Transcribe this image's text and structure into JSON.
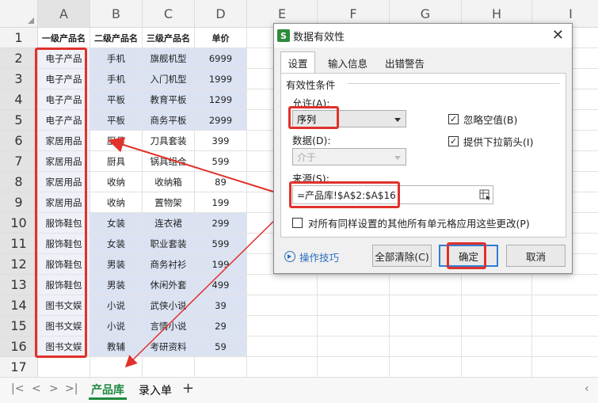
{
  "columns": [
    "A",
    "B",
    "C",
    "D",
    "E",
    "F",
    "G",
    "H",
    "I"
  ],
  "row_numbers": [
    "1",
    "2",
    "3",
    "4",
    "5",
    "6",
    "7",
    "8",
    "9",
    "10",
    "11",
    "12",
    "13",
    "14",
    "15",
    "16",
    "17"
  ],
  "headers": [
    "一级产品名",
    "二级产品名",
    "三级产品名",
    "单价"
  ],
  "rows": [
    [
      "电子产品",
      "手机",
      "旗舰机型",
      "6999"
    ],
    [
      "电子产品",
      "手机",
      "入门机型",
      "1999"
    ],
    [
      "电子产品",
      "平板",
      "教育平板",
      "1299"
    ],
    [
      "电子产品",
      "平板",
      "商务平板",
      "2999"
    ],
    [
      "家居用品",
      "厨具",
      "刀具套装",
      "399"
    ],
    [
      "家居用品",
      "厨具",
      "锅具组合",
      "599"
    ],
    [
      "家居用品",
      "收纳",
      "收纳箱",
      "89"
    ],
    [
      "家居用品",
      "收纳",
      "置物架",
      "199"
    ],
    [
      "服饰鞋包",
      "女装",
      "连衣裙",
      "299"
    ],
    [
      "服饰鞋包",
      "女装",
      "职业套装",
      "599"
    ],
    [
      "服饰鞋包",
      "男装",
      "商务衬衫",
      "199"
    ],
    [
      "服饰鞋包",
      "男装",
      "休闲外套",
      "499"
    ],
    [
      "图书文娱",
      "小说",
      "武侠小说",
      "39"
    ],
    [
      "图书文娱",
      "小说",
      "言情小说",
      "29"
    ],
    [
      "图书文娱",
      "教辅",
      "考研资料",
      "59"
    ]
  ],
  "sheet_tabs": {
    "active": "产品库",
    "other": "录入单"
  },
  "nav": {
    "first": "|<",
    "prev": "<",
    "next": ">",
    "last": ">|",
    "add": "+",
    "end": "‹"
  },
  "dialog": {
    "icon_letter": "S",
    "title": "数据有效性",
    "close": "✕",
    "tabs": [
      "设置",
      "输入信息",
      "出错警告"
    ],
    "group_label": "有效性条件",
    "allow_label": "允许(A):",
    "allow_value": "序列",
    "data_label": "数据(D):",
    "data_value": "介于",
    "ignore_blank": "忽略空值(B)",
    "dropdown_arrow": "提供下拉箭头(I)",
    "source_label": "来源(S):",
    "source_value": "=产品库!$A$2:$A$16",
    "apply_all": "对所有同样设置的其他所有单元格应用这些更改(P)",
    "help": "操作技巧",
    "clear_all": "全部清除(C)",
    "ok": "确定",
    "cancel": "取消",
    "check_mark": "✓"
  },
  "colors": {
    "accent_red": "#e0312b",
    "highlight_blue": "#dbe3f3",
    "tab_green": "#1f8a3f"
  }
}
